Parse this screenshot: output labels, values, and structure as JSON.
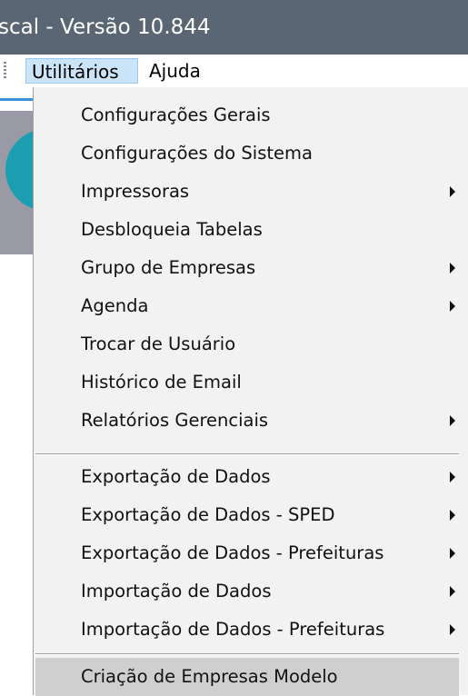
{
  "window": {
    "title": "scal - Versão 10.844"
  },
  "menubar": {
    "items": [
      {
        "label": "Utilitários"
      },
      {
        "label": "Ajuda"
      }
    ]
  },
  "dropdown": {
    "items": [
      {
        "label": "Configurações Gerais",
        "submenu": false
      },
      {
        "label": "Configurações do Sistema",
        "submenu": false
      },
      {
        "label": "Impressoras",
        "submenu": true
      },
      {
        "label": "Desbloqueia Tabelas",
        "submenu": false
      },
      {
        "label": "Grupo de Empresas",
        "submenu": true
      },
      {
        "label": "Agenda",
        "submenu": true
      },
      {
        "label": "Trocar de Usuário",
        "submenu": false
      },
      {
        "label": "Histórico de Email",
        "submenu": false
      },
      {
        "label": "Relatórios Gerenciais",
        "submenu": true
      },
      {
        "label": "Exportação de Dados",
        "submenu": true
      },
      {
        "label": "Exportação de Dados - SPED",
        "submenu": true
      },
      {
        "label": "Exportação de Dados - Prefeituras",
        "submenu": true
      },
      {
        "label": "Importação de Dados",
        "submenu": true
      },
      {
        "label": "Importação de Dados - Prefeituras",
        "submenu": true
      },
      {
        "label": "Criação de Empresas Modelo",
        "submenu": false,
        "highlighted": true
      }
    ]
  },
  "colors": {
    "titlebar": "#5a6673",
    "menu_active": "#cce4f7",
    "dropdown_bg": "#f2f2f2",
    "highlight": "#cfcfcf",
    "accent_blue": "#3d8fd8",
    "teal": "#1b9fb0"
  }
}
